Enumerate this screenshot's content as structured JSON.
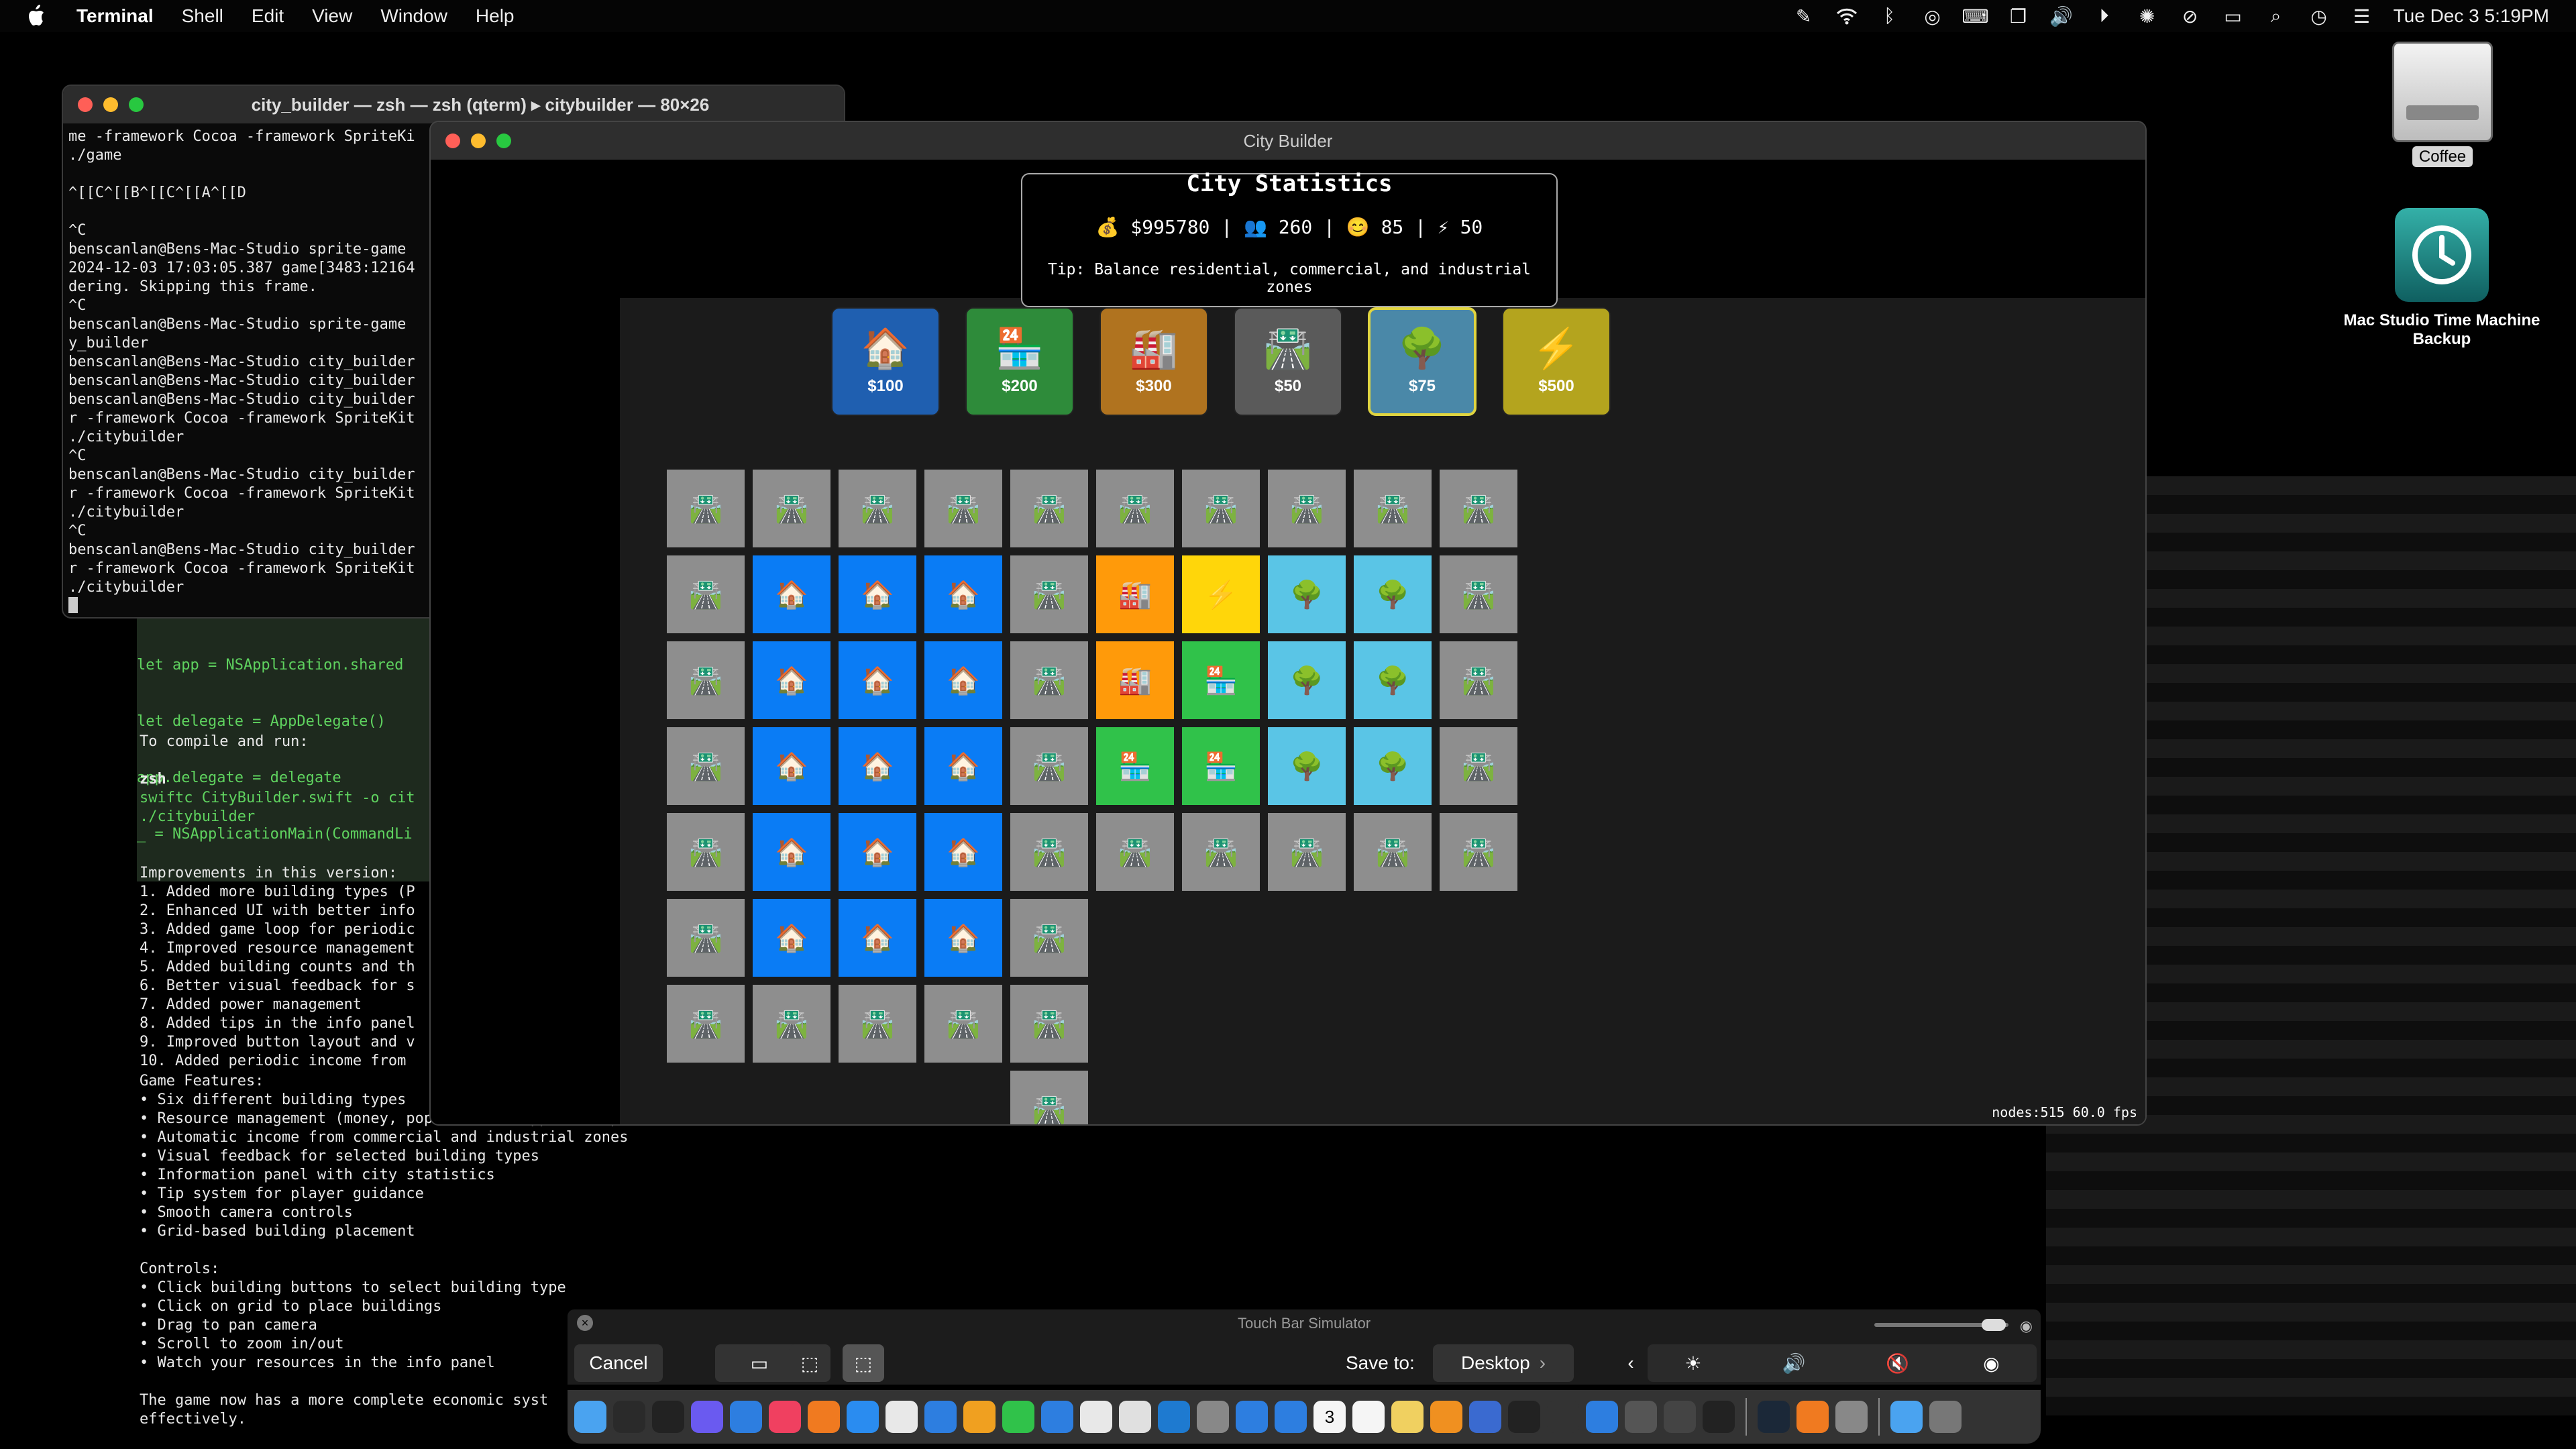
{
  "menubar": {
    "app_name": "Terminal",
    "items": [
      "Shell",
      "Edit",
      "View",
      "Window",
      "Help"
    ],
    "clock": "Tue Dec 3  5:19PM"
  },
  "desktop": {
    "icons": [
      {
        "label": "Coffee"
      },
      {
        "label": "Mac Studio Time Machine Backup"
      }
    ]
  },
  "back_terminal": {
    "lines_top": [
      "let app = NSApplication.shared",
      "let delegate = AppDelegate()",
      "app.delegate = delegate",
      "_ = NSApplicationMain(CommandLi"
    ],
    "compile_heading": "To compile and run:",
    "shell": "zsh",
    "cmd1": "swiftc CityBuilder.swift -o cit",
    "cmd2": "./citybuilder",
    "improvements_heading": "Improvements in this version:",
    "improvements": [
      "1. Added more building types (P",
      "2. Enhanced UI with better info",
      "3. Added game loop for periodic",
      "4. Improved resource management",
      "5. Added building counts and th",
      "6. Better visual feedback for s",
      "7. Added power management",
      "8. Added tips in the info panel",
      "9. Improved button layout and v",
      "10. Added periodic income from"
    ],
    "features_heading": "Game Features:",
    "features": [
      "• Six different building types",
      "• Resource management (money, population, happiness, power)",
      "• Automatic income from commercial and industrial zones",
      "• Visual feedback for selected building types",
      "• Information panel with city statistics",
      "• Tip system for player guidance",
      "• Smooth camera controls",
      "• Grid-based building placement"
    ],
    "controls_heading": "Controls:",
    "controls": [
      "• Click building buttons to select building type",
      "• Click on grid to place buildings",
      "• Drag to pan camera",
      "• Scroll to zoom in/out",
      "• Watch your resources in the info panel"
    ],
    "footer": [
      "The game now has a more complete economic syst",
      "effectively."
    ]
  },
  "terminal": {
    "title": "city_builder — zsh — zsh (qterm) ▸ citybuilder — 80×26",
    "lines": [
      "me -framework Cocoa -framework SpriteKi",
      "./game",
      "",
      "^[[C^[[B^[[C^[[A^[[D",
      "",
      "^C",
      "benscanlan@Bens-Mac-Studio sprite-game",
      "2024-12-03 17:03:05.387 game[3483:12164",
      "dering. Skipping this frame.",
      "^C",
      "benscanlan@Bens-Mac-Studio sprite-game",
      "y_builder",
      "benscanlan@Bens-Mac-Studio city_builder",
      "benscanlan@Bens-Mac-Studio city_builder",
      "benscanlan@Bens-Mac-Studio city_builder",
      "r -framework Cocoa -framework SpriteKit",
      "./citybuilder",
      "^C",
      "benscanlan@Bens-Mac-Studio city_builder",
      "r -framework Cocoa -framework SpriteKit",
      "./citybuilder",
      "^C",
      "benscanlan@Bens-Mac-Studio city_builder",
      "r -framework Cocoa -framework SpriteKit",
      "./citybuilder"
    ]
  },
  "game": {
    "title": "City Builder",
    "stats_title": "City Statistics",
    "stats_line": "💰 $995780 | 👥 260 | 😊 85 | ⚡ 50",
    "tip": "Tip: Balance residential, commercial, and industrial zones",
    "buttons": [
      {
        "emoji": "🏠",
        "price": "$100",
        "color": "#1f5fb0"
      },
      {
        "emoji": "🏪",
        "price": "$200",
        "color": "#2e8b3a"
      },
      {
        "emoji": "🏭",
        "price": "$300",
        "color": "#b0731f"
      },
      {
        "emoji": "🛣️",
        "price": "$50",
        "color": "#5a5a5a"
      },
      {
        "emoji": "🌳",
        "price": "$75",
        "color": "#4a88a8"
      },
      {
        "emoji": "⚡",
        "price": "$500",
        "color": "#b4a41e"
      }
    ],
    "selected_button": 4,
    "legend": {
      "R": {
        "emoji": "🛣️",
        "color": "#8e8e8e"
      },
      "H": {
        "emoji": "🏠",
        "color": "#0a7cf5"
      },
      "I": {
        "emoji": "🏭",
        "color": "#ff9a0a"
      },
      "P": {
        "emoji": "⚡",
        "color": "#ffd60a"
      },
      "T": {
        "emoji": "🌳",
        "color": "#5ac5e6"
      },
      "C": {
        "emoji": "🏪",
        "color": "#30c24a"
      }
    },
    "grid": [
      "RRRRRRRRRR",
      "RHHHRIPTTR",
      "RHHHRICTTR",
      "RHHHRCCTTR",
      "RHHHRRRRRR",
      "RHHHR",
      "RRRRR",
      "....R"
    ],
    "stats_debug": "nodes:515   60.0 fps"
  },
  "touchbar": {
    "title": "Touch Bar Simulator",
    "cancel": "Cancel",
    "save_to_label": "Save to:",
    "save_to_value": "Desktop"
  },
  "dock": {
    "apps": [
      "finder",
      "activity",
      "terminal",
      "notes",
      "xcode-like",
      "music",
      "firefox",
      "safari",
      "chatgpt",
      "xcode",
      "pages",
      "messages",
      "mail",
      "chrome",
      "doc",
      "vscode",
      "prefs",
      "appstore",
      "store",
      "calendar",
      "reminders",
      "notes2",
      "pencil",
      "files",
      "camera",
      "grid",
      "zoom",
      "search",
      "photo",
      "unity",
      "steam",
      "firefox2",
      "preview",
      "folder",
      "trash"
    ],
    "calendar_day": "3"
  }
}
